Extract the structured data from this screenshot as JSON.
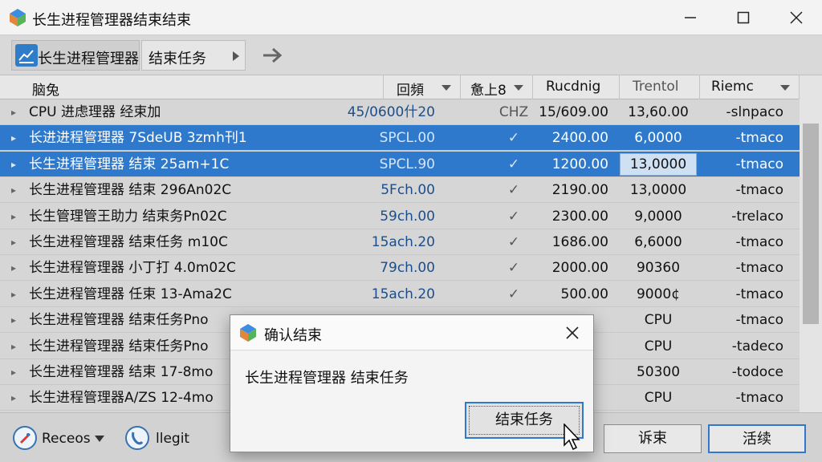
{
  "window": {
    "title": "长生进程管理器结束结束",
    "minimize_icon": "minimize-icon",
    "maximize_icon": "maximize-icon",
    "close_icon": "close-icon"
  },
  "toolbar": {
    "app_label": "长生进程管理器",
    "tab_label": "结束任务"
  },
  "columns": [
    {
      "label": "脑兔"
    },
    {
      "label": "回頻"
    },
    {
      "label": "惫上8"
    },
    {
      "label": "Rucdnig"
    },
    {
      "label": "Trentol"
    },
    {
      "label": "Riemc"
    }
  ],
  "rows": [
    {
      "name": "CPU 进虑理器   经束加",
      "v1": "45/0600什20",
      "chk": "CHZ",
      "v2": "15/609.00",
      "v3": "13,60.00",
      "v4": "-slnpaco",
      "selected": false
    },
    {
      "name": "长进进程管理器  7SdeUB 3zmh刊1",
      "v1": "SPCL.00",
      "chk": "✓",
      "v2": "2400.00",
      "v3": "6,0000",
      "v4": "-tmaco",
      "selected": true
    },
    {
      "name": "长生进程管理器  结束  25am+1C",
      "v1": "SPCL.90",
      "chk": "✓",
      "v2": "1200.00",
      "v3": "13,0000",
      "v4": "-tmaco",
      "selected": true
    },
    {
      "name": "长生进程管理器   结束 296An02C",
      "v1": "5Fch.00",
      "chk": "✓",
      "v2": "2190.00",
      "v3": "13,0000",
      "v4": "-tmaco",
      "selected": false
    },
    {
      "name": "长生管理管王助力  结束务Pn02C",
      "v1": "59ch.00",
      "chk": "✓",
      "v2": "2300.00",
      "v3": "9,0000",
      "v4": "-trelaco",
      "selected": false
    },
    {
      "name": "长生进程管理器  结束任务  m10C",
      "v1": "15ach.20",
      "chk": "✓",
      "v2": "1686.00",
      "v3": "6,6000",
      "v4": "-tmaco",
      "selected": false
    },
    {
      "name": "长生进程管理器   小丁打 4.0m02C",
      "v1": "79ch.00",
      "chk": "✓",
      "v2": "2000.00",
      "v3": "90360",
      "v4": "-tmaco",
      "selected": false
    },
    {
      "name": "长生进程管理器   任束  13-Ama2C",
      "v1": "15ach.20",
      "chk": "✓",
      "v2": "500.00",
      "v3": "9000¢",
      "v4": "-tmaco",
      "selected": false
    },
    {
      "name": "长生进程管理器   结束任务Pno",
      "v1": "",
      "chk": "",
      "v2": "",
      "v3": "CPU",
      "v4": "-tmaco",
      "selected": false
    },
    {
      "name": "长生进程管理器   结束任务Pno",
      "v1": "",
      "chk": "",
      "v2": "",
      "v3": "CPU",
      "v4": "-tadeco",
      "selected": false
    },
    {
      "name": "长生进程管理器   结束  17-8mo",
      "v1": "",
      "chk": "",
      "v2": "",
      "v3": "50300",
      "v4": "-todoce",
      "selected": false
    },
    {
      "name": "长生进程管理器A/ZS   12-4mo",
      "v1": "",
      "chk": "",
      "v2": "",
      "v3": "CPU",
      "v4": "-tmaco",
      "selected": false
    }
  ],
  "statusbar": {
    "left_label": "Receos",
    "mid_label": "llegit",
    "btn_cancel": "诉束",
    "btn_ok": "活续"
  },
  "dialog": {
    "title": "确认结束",
    "message": "长生进程管理器  结束任务",
    "confirm_label": "结束任务"
  },
  "colors": {
    "selection": "#2e79cc",
    "accent": "#2e79cc"
  }
}
